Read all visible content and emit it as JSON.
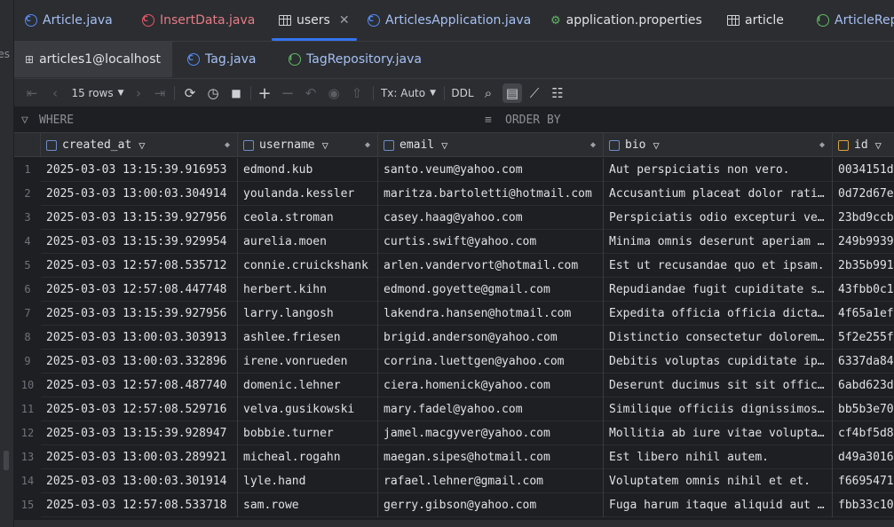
{
  "left_fragment": "les",
  "editor_tabs": [
    {
      "label": "Article.java",
      "icon": "class-icon",
      "color": "#548af7"
    },
    {
      "label": "InsertData.java",
      "icon": "class-icon",
      "color": "#e55765"
    },
    {
      "label": "users",
      "icon": "table-icon",
      "active": true
    },
    {
      "label": "ArticlesApplication.java",
      "icon": "spring-class-icon",
      "color": "#548af7"
    },
    {
      "label": "application.properties",
      "icon": "properties-icon"
    },
    {
      "label": "article",
      "icon": "table-icon"
    },
    {
      "label": "ArticleRepo",
      "icon": "interface-icon",
      "color": "#548af7"
    }
  ],
  "secondary_tabs": [
    {
      "label": "articles1@localhost",
      "icon": "console-icon",
      "selected": true
    },
    {
      "label": "Tag.java",
      "icon": "class-icon"
    },
    {
      "label": "TagRepository.java",
      "icon": "interface-icon"
    }
  ],
  "toolbar": {
    "rows_label": "15 rows",
    "tx_label": "Tx: Auto",
    "ddl_label": "DDL"
  },
  "filter": {
    "where_label": "WHERE",
    "order_label": "ORDER BY"
  },
  "columns": [
    "created_at",
    "username",
    "email",
    "bio",
    "id"
  ],
  "rows": [
    [
      "1",
      "2025-03-03 13:15:39.916953",
      "edmond.kub",
      "santo.veum@yahoo.com",
      "Aut perspiciatis non vero.",
      "0034151d"
    ],
    [
      "2",
      "2025-03-03 13:00:03.304914",
      "youlanda.kessler",
      "maritza.bartoletti@hotmail.com",
      "Accusantium placeat dolor rati…",
      "0d72d67e"
    ],
    [
      "3",
      "2025-03-03 13:15:39.927956",
      "ceola.stroman",
      "casey.haag@yahoo.com",
      "Perspiciatis odio excepturi ve…",
      "23bd9ccb"
    ],
    [
      "4",
      "2025-03-03 13:15:39.929954",
      "aurelia.moen",
      "curtis.swift@yahoo.com",
      "Minima omnis deserunt aperiam …",
      "249b9939"
    ],
    [
      "5",
      "2025-03-03 12:57:08.535712",
      "connie.cruickshank",
      "arlen.vandervort@hotmail.com",
      "Est ut recusandae quo et ipsam.",
      "2b35b991"
    ],
    [
      "6",
      "2025-03-03 12:57:08.447748",
      "herbert.kihn",
      "edmond.goyette@gmail.com",
      "Repudiandae fugit cupiditate s…",
      "43fbb0c1"
    ],
    [
      "7",
      "2025-03-03 13:15:39.927956",
      "larry.langosh",
      "lakendra.hansen@hotmail.com",
      "Expedita officia officia dicta…",
      "4f65a1ef"
    ],
    [
      "8",
      "2025-03-03 13:00:03.303913",
      "ashlee.friesen",
      "brigid.anderson@yahoo.com",
      "Distinctio consectetur dolorem…",
      "5f2e255f"
    ],
    [
      "9",
      "2025-03-03 13:00:03.332896",
      "irene.vonrueden",
      "corrina.luettgen@yahoo.com",
      "Debitis voluptas cupiditate ip…",
      "6337da84"
    ],
    [
      "10",
      "2025-03-03 12:57:08.487740",
      "domenic.lehner",
      "ciera.homenick@yahoo.com",
      "Deserunt ducimus sit sit offic…",
      "6abd623d"
    ],
    [
      "11",
      "2025-03-03 12:57:08.529716",
      "velva.gusikowski",
      "mary.fadel@yahoo.com",
      "Similique officiis dignissimos…",
      "bb5b3e70"
    ],
    [
      "12",
      "2025-03-03 13:15:39.928947",
      "bobbie.turner",
      "jamel.macgyver@yahoo.com",
      "Mollitia ab iure vitae volupta…",
      "cf4bf5d8"
    ],
    [
      "13",
      "2025-03-03 13:00:03.289921",
      "micheal.rogahn",
      "maegan.sipes@hotmail.com",
      "Est libero nihil autem.",
      "d49a3016"
    ],
    [
      "14",
      "2025-03-03 13:00:03.301914",
      "lyle.hand",
      "rafael.lehner@gmail.com",
      "Voluptatem omnis nihil et et.",
      "f6695471"
    ],
    [
      "15",
      "2025-03-03 12:57:08.533718",
      "sam.rowe",
      "gerry.gibson@yahoo.com",
      "Fuga harum itaque aliquid aut …",
      "fbb33c10"
    ]
  ],
  "colors": {
    "accent": "#3574f0",
    "background": "#1e1f22",
    "panel": "#2b2d30"
  }
}
